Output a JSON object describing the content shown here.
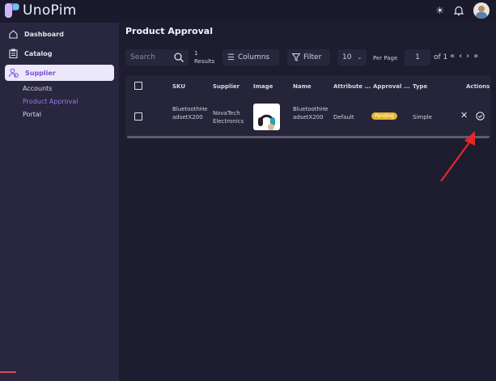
{
  "app": {
    "name": "UnoPim"
  },
  "sidebar": {
    "items": [
      {
        "label": "Dashboard"
      },
      {
        "label": "Catalog"
      },
      {
        "label": "Supplier"
      }
    ],
    "sub_items": [
      {
        "label": "Accounts"
      },
      {
        "label": "Product Approval"
      },
      {
        "label": "Portal"
      }
    ]
  },
  "page": {
    "title": "Product Approval"
  },
  "toolbar": {
    "search_placeholder": "Search",
    "results_count": "1",
    "results_label": "Results",
    "columns_label": "Columns",
    "filter_label": "Filter",
    "per_page_value": "10",
    "per_page_label": "Per Page",
    "page_value": "1",
    "page_of": "of 1"
  },
  "table": {
    "headers": [
      "SKU",
      "Supplier",
      "Image",
      "Name",
      "Attribute ...",
      "Approval ...",
      "Type",
      "Actions"
    ],
    "rows": [
      {
        "sku": "BluetoothHeadsetX200",
        "supplier": "NovaTech Electronics",
        "name": "BluetoothHeadsetX200",
        "attribute": "Default",
        "approval": "Pending",
        "type": "Simple"
      }
    ]
  },
  "colors": {
    "accent": "#7a4fd6",
    "pending": "#e3b52a",
    "arrow": "#e8262a"
  }
}
